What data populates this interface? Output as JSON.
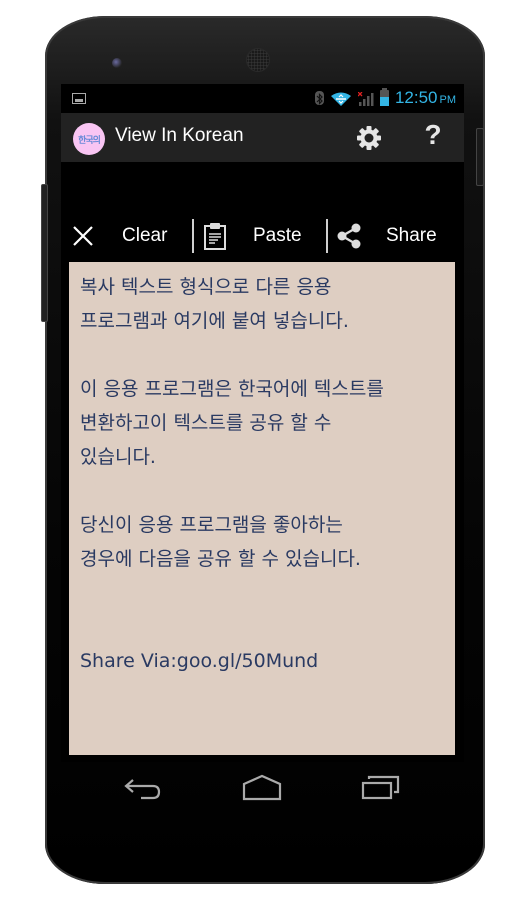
{
  "status_bar": {
    "time": "12:50",
    "ampm": "PM",
    "icons": [
      "notification-image-icon",
      "bluetooth-icon",
      "wifi-icon",
      "signal-no-data-icon",
      "battery-icon"
    ]
  },
  "action_bar": {
    "logo_text": "한국의",
    "title": "View In Korean",
    "settings_icon": "gear-icon",
    "help_label": "?"
  },
  "toolbar": {
    "clear_label": "Clear",
    "paste_label": "Paste",
    "share_label": "Share"
  },
  "content": {
    "paragraphs": [
      "복사 텍스트 형식으로 다른 응용\n프로그램과 여기에 붙여 넣습니다.",
      "이 응용 프로그램은 한국어에 텍스트를\n변환하고이 텍스트를 공유 할 수\n있습니다.",
      "당신이 응용 프로그램을 좋아하는\n경우에 다음을 공유 할 수 있습니다.",
      "Share Via:goo.gl/50Mund"
    ]
  },
  "nav_bar": {
    "back": "back-icon",
    "home": "home-icon",
    "recents": "recents-icon"
  },
  "colors": {
    "accent": "#33b5e5",
    "content_bg": "#decec2",
    "content_text": "#2a3a62",
    "action_bar_bg": "#222222",
    "logo_bg": "#f9c5f3"
  }
}
